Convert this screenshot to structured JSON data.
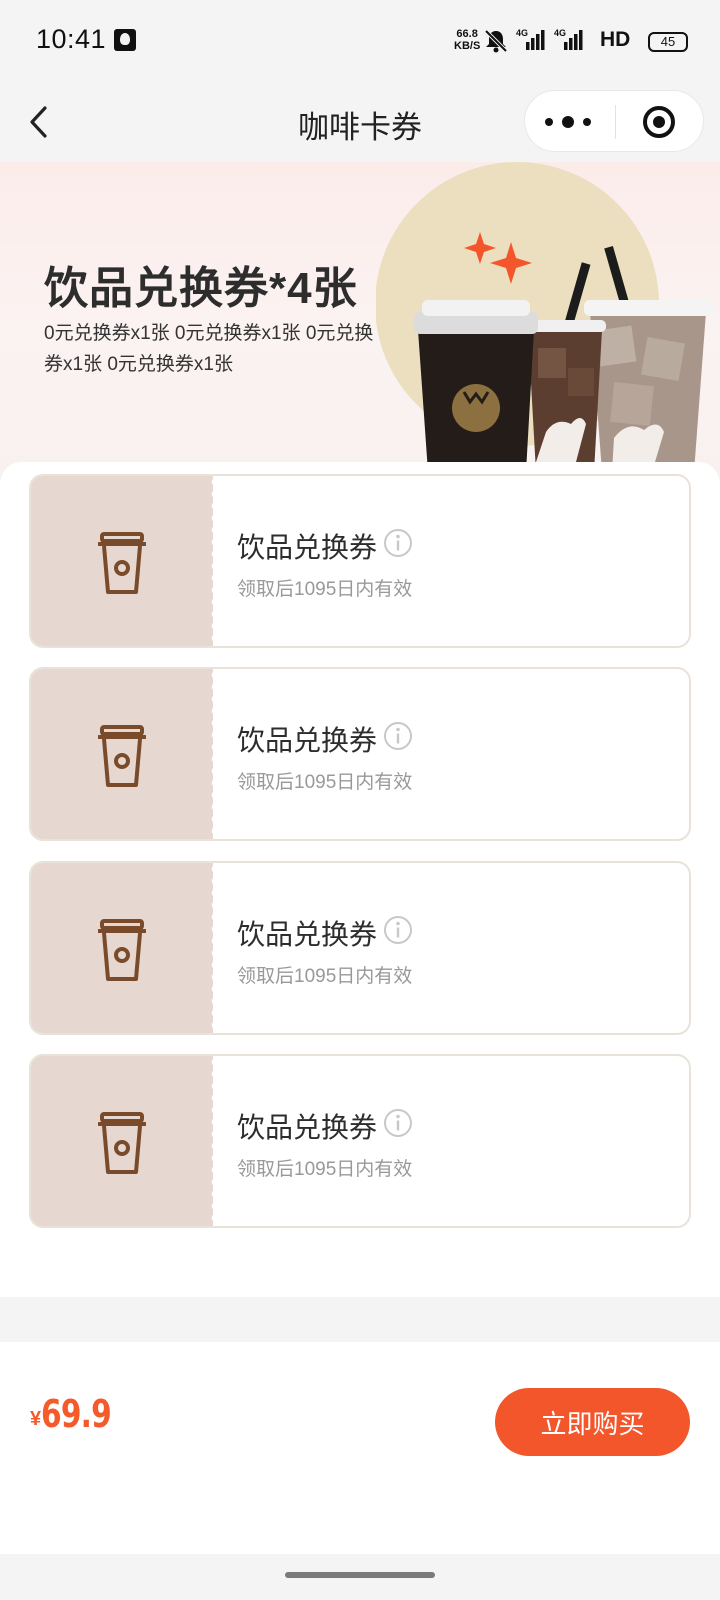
{
  "status_bar": {
    "time": "10:41",
    "net_speed_value": "66.8",
    "net_speed_unit": "KB/S",
    "network_label_1": "4G",
    "network_label_2": "4G",
    "hd_label": "HD",
    "battery": "45"
  },
  "nav": {
    "title": "咖啡卡券"
  },
  "banner": {
    "title": "饮品兑换券*4张",
    "description": "0元兑换券x1张 0元兑换券x1张 0元兑换券x1张 0元兑换券x1张"
  },
  "coupons": [
    {
      "name": "饮品兑换券",
      "validity": "领取后1095日内有效",
      "icon": "coffee-cup-icon"
    },
    {
      "name": "饮品兑换券",
      "validity": "领取后1095日内有效",
      "icon": "coffee-cup-icon"
    },
    {
      "name": "饮品兑换券",
      "validity": "领取后1095日内有效",
      "icon": "coffee-cup-icon"
    },
    {
      "name": "饮品兑换券",
      "validity": "领取后1095日内有效",
      "icon": "coffee-cup-icon"
    }
  ],
  "footer": {
    "currency_symbol": "¥",
    "price": "69.9",
    "buy_label": "立即购买"
  },
  "colors": {
    "accent": "#f4562c",
    "coupon_stub": "#e6d8d0",
    "cup_brown": "#7a4b2a"
  }
}
